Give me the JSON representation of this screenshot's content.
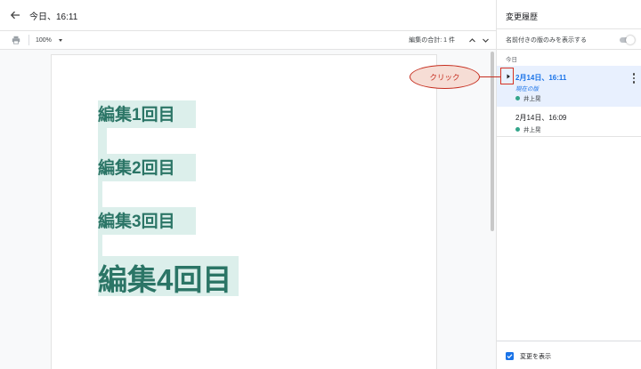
{
  "header": {
    "title": "今日、16:11"
  },
  "toolbar": {
    "zoom": "100%",
    "edit_count": "編集の合計: 1 件"
  },
  "document": {
    "edits": [
      "編集1回目",
      "編集2回目",
      "編集3回目",
      "編集4回目"
    ],
    "highlight_color": "#dcefeb",
    "text_color": "#2b7566"
  },
  "panel": {
    "title": "変更履歴",
    "named_only_label": "名前付きの版のみを表示する",
    "today_label": "今日",
    "versions": [
      {
        "time": "2月14日、16:11",
        "current_label": "現在の版",
        "author": "井上晃"
      },
      {
        "time": "2月14日、16:09",
        "author": "井上晃"
      }
    ],
    "show_changes_label": "変更を表示"
  },
  "annotation": {
    "text": "クリック",
    "color": "#c62e1f"
  }
}
